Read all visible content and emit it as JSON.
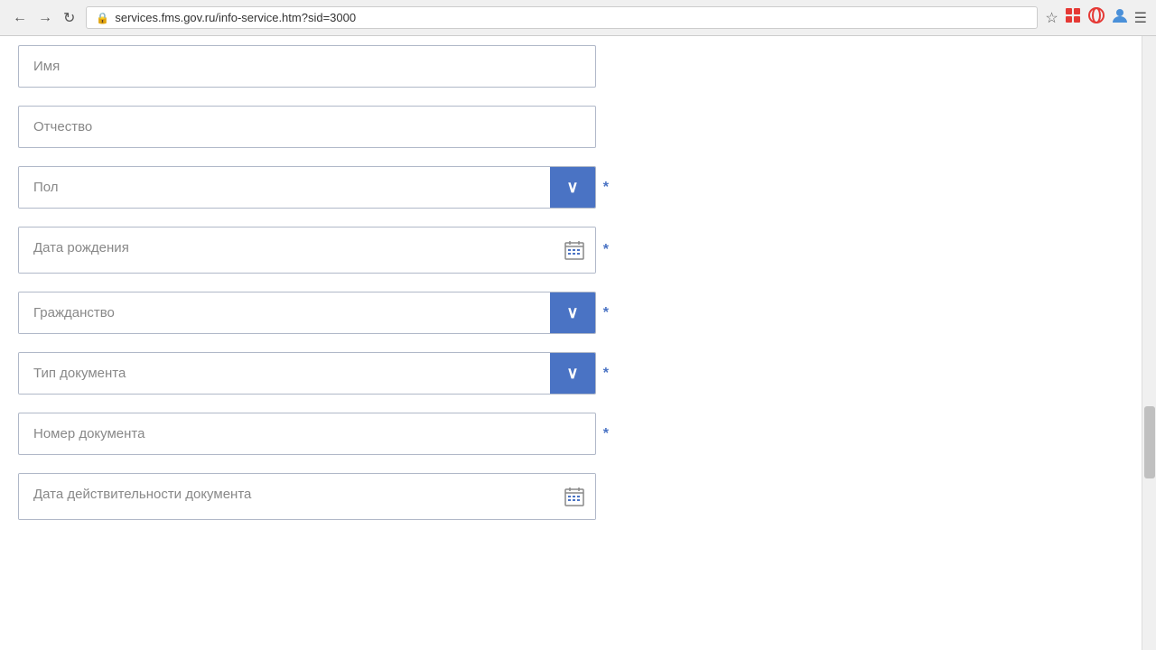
{
  "browser": {
    "url": "services.fms.gov.ru/info-service.htm?sid=3000",
    "back_label": "←",
    "forward_label": "→",
    "refresh_label": "↻",
    "star_label": "☆",
    "menu_label": "≡"
  },
  "form": {
    "fields": [
      {
        "id": "imya",
        "type": "input",
        "placeholder": "Имя",
        "required": false
      },
      {
        "id": "otchestvo",
        "type": "input",
        "placeholder": "Отчество",
        "required": false
      },
      {
        "id": "pol",
        "type": "select",
        "placeholder": "Пол",
        "required": true
      },
      {
        "id": "data_rozhdeniya",
        "type": "date",
        "placeholder": "Дата рождения",
        "required": true
      },
      {
        "id": "grazhdanstvo",
        "type": "select",
        "placeholder": "Гражданство",
        "required": true
      },
      {
        "id": "tip_dokumenta",
        "type": "select",
        "placeholder": "Тип документа",
        "required": true
      },
      {
        "id": "nomer_dokumenta",
        "type": "input",
        "placeholder": "Номер документа",
        "required": true
      },
      {
        "id": "data_deystvitelnosti",
        "type": "date",
        "placeholder": "Дата действительности документа",
        "required": false
      }
    ]
  }
}
